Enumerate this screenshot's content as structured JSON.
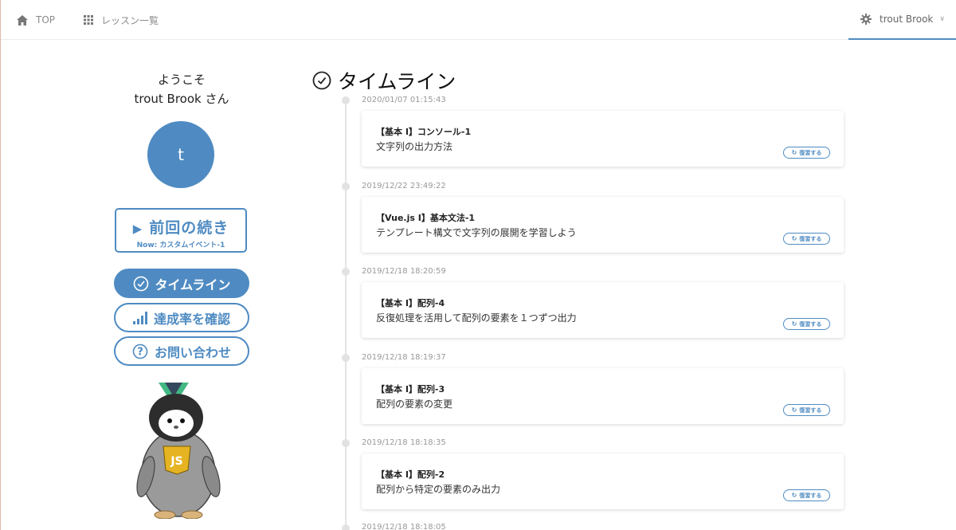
{
  "nav": {
    "top_label": "TOP",
    "lessons_label": "レッスン一覧",
    "user_label": "trout Brook",
    "user_icon": "gear-icon",
    "user_chevron": "chevron-down-icon"
  },
  "sidebar": {
    "welcome_line1": "ようこそ",
    "welcome_line2": "trout Brook さん",
    "avatar_letter": "t",
    "continue_label": "前回の続き",
    "continue_sub": "Now: カスタムイベント-1",
    "timeline_label": "タイムライン",
    "progress_label": "達成率を確認",
    "contact_label": "お問い合わせ",
    "mascot_badge": "JS"
  },
  "timeline": {
    "title": "タイムライン",
    "review_label": "復習する",
    "entries": [
      {
        "date": "2020/01/07 01:15:43",
        "title": "【基本 I】コンソール-1",
        "desc": "文字列の出力方法"
      },
      {
        "date": "2019/12/22 23:49:22",
        "title": "【Vue.js I】基本文法-1",
        "desc": "テンプレート構文で文字列の展開を学習しよう"
      },
      {
        "date": "2019/12/18 18:20:59",
        "title": "【基本 I】配列-4",
        "desc": "反復処理を活用して配列の要素を１つずつ出力"
      },
      {
        "date": "2019/12/18 18:19:37",
        "title": "【基本 I】配列-3",
        "desc": "配列の要素の変更"
      },
      {
        "date": "2019/12/18 18:18:35",
        "title": "【基本 I】配列-2",
        "desc": "配列から特定の要素のみ出力"
      },
      {
        "date": "2019/12/18 18:18:05"
      }
    ]
  },
  "colors": {
    "accent": "#4f8bc2",
    "nav_text": "#8a8a8a",
    "timeline_line": "#e4e4e4"
  }
}
